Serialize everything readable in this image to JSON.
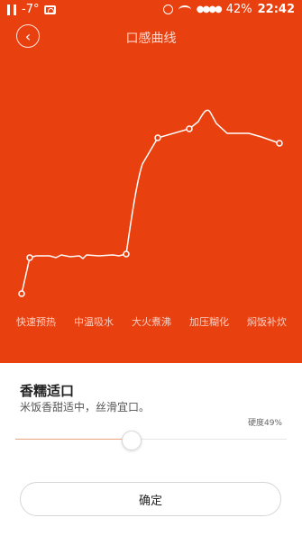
{
  "status_bar": {
    "temperature": "-7°",
    "battery": "42%",
    "time": "22:42",
    "icons": [
      "pause-icon",
      "camera-icon",
      "alarm-icon",
      "wifi-icon",
      "signal-icon"
    ]
  },
  "header": {
    "title": "口感曲线"
  },
  "chart_data": {
    "type": "line",
    "categories": [
      "快速预热",
      "中温吸水",
      "大火煮沸",
      "加压糊化",
      "焖饭补炊"
    ]
  },
  "taste": {
    "name": "香糯适口",
    "description": "米饭香甜适中，丝滑宜口。",
    "hardness_label": "硬度49%",
    "hardness_value": 0.43
  },
  "actions": {
    "confirm_label": "确定"
  },
  "colors": {
    "accent": "#e9400f",
    "slider_fill": "#e9a27c"
  }
}
